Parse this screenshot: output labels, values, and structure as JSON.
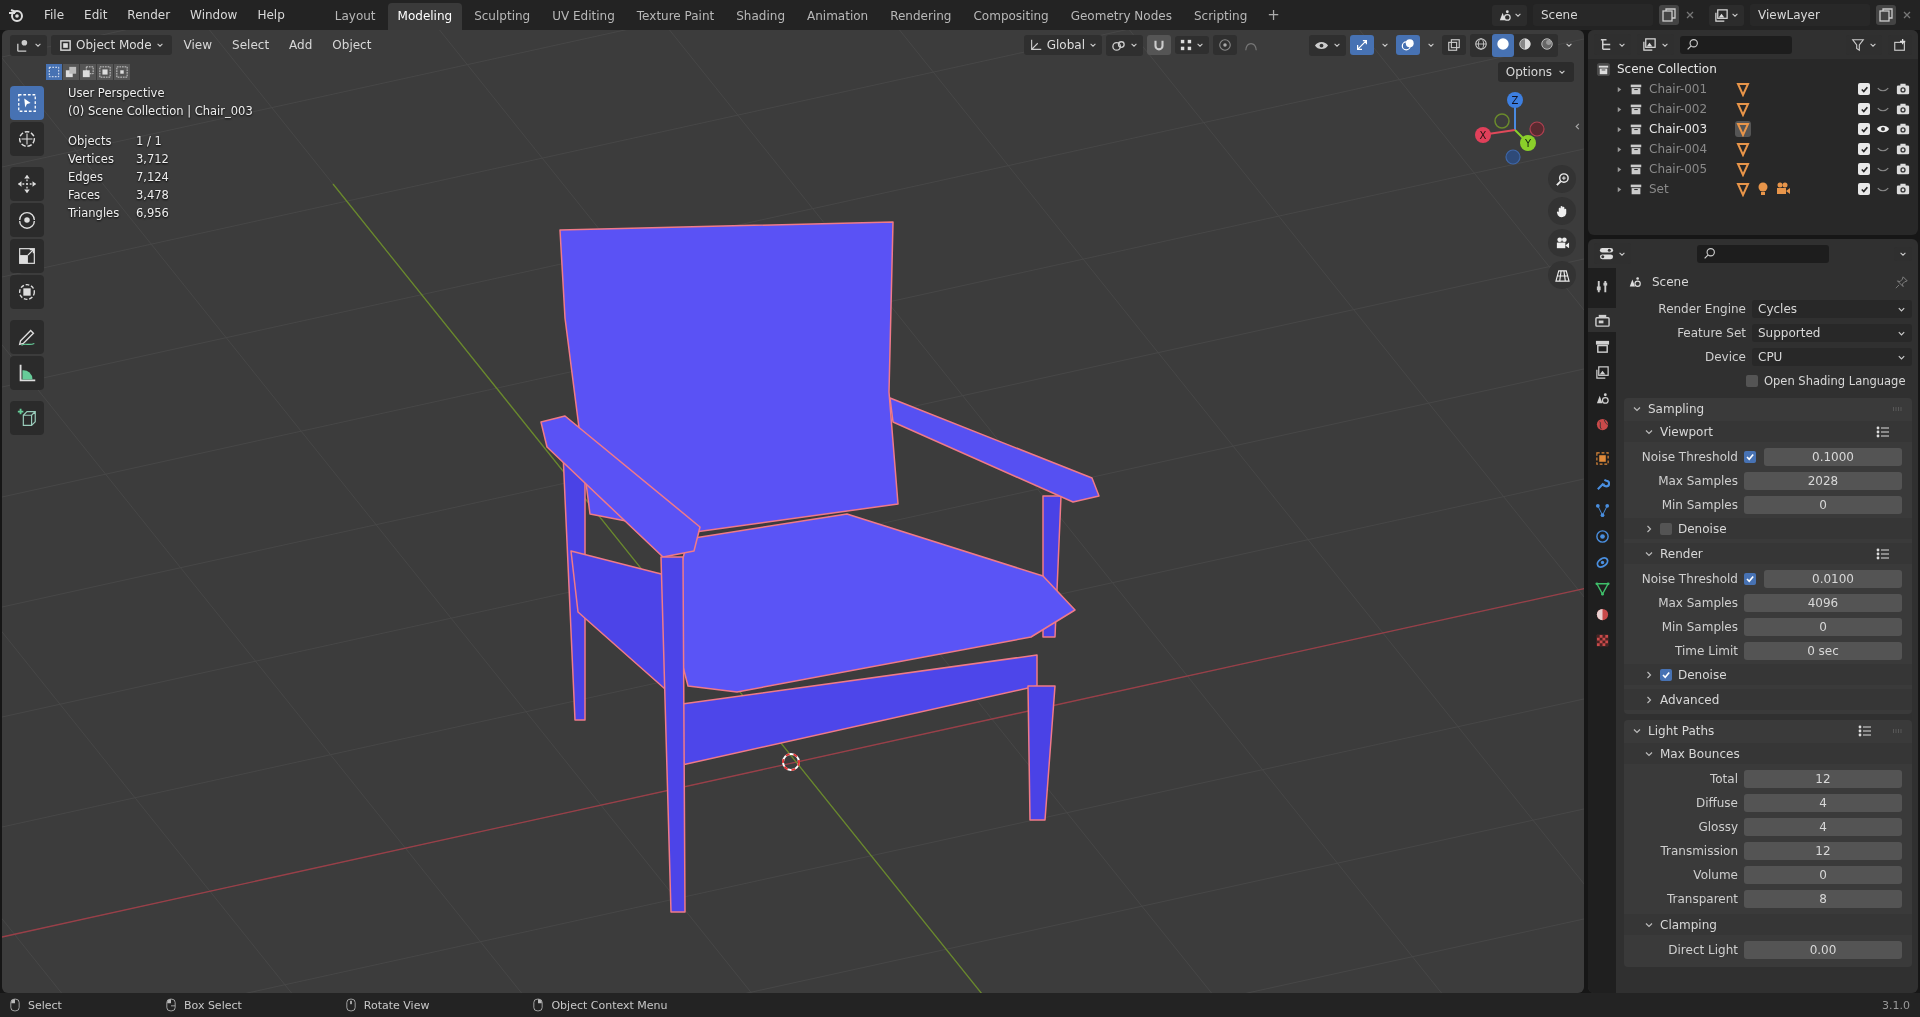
{
  "menu": [
    "File",
    "Edit",
    "Render",
    "Window",
    "Help"
  ],
  "workspaces": [
    {
      "label": "Layout",
      "selected": false
    },
    {
      "label": "Modeling",
      "selected": true
    },
    {
      "label": "Sculpting",
      "selected": false
    },
    {
      "label": "UV Editing",
      "selected": false
    },
    {
      "label": "Texture Paint",
      "selected": false
    },
    {
      "label": "Shading",
      "selected": false
    },
    {
      "label": "Animation",
      "selected": false
    },
    {
      "label": "Rendering",
      "selected": false
    },
    {
      "label": "Compositing",
      "selected": false
    },
    {
      "label": "Geometry Nodes",
      "selected": false
    },
    {
      "label": "Scripting",
      "selected": false
    }
  ],
  "add_workspace": "+",
  "scene_field": "Scene",
  "view_layer_field": "ViewLayer",
  "viewport": {
    "mode": "Object Mode",
    "menus": [
      "View",
      "Select",
      "Add",
      "Object"
    ],
    "orientation": "Global",
    "toggles": {
      "snapping": true,
      "proportional_editing": false,
      "gizmos": true,
      "overlays": true,
      "xray": false
    },
    "shading": [
      {
        "kind": "wireframe",
        "selected": false
      },
      {
        "kind": "solid",
        "selected": true
      },
      {
        "kind": "material",
        "selected": false
      },
      {
        "kind": "rendered",
        "selected": false
      }
    ],
    "select_modes": [
      {
        "kind": "new",
        "selected": true
      },
      {
        "kind": "extend",
        "selected": false
      },
      {
        "kind": "subtract",
        "selected": false
      },
      {
        "kind": "invert",
        "selected": false
      },
      {
        "kind": "intersect",
        "selected": false
      }
    ],
    "options": "Options",
    "tools": [
      {
        "kind": "select",
        "selected": true
      },
      {
        "kind": "cursor",
        "selected": false
      },
      {
        "kind": "move",
        "selected": false
      },
      {
        "kind": "rotate",
        "selected": false
      },
      {
        "kind": "scale",
        "selected": false
      },
      {
        "kind": "transform",
        "selected": false
      },
      {
        "kind": "annotate",
        "selected": false
      },
      {
        "kind": "measure",
        "selected": false
      },
      {
        "kind": "add_cube",
        "selected": false
      }
    ],
    "overlay_lines": [
      "User Perspective",
      "(0) Scene Collection | Chair_003"
    ],
    "stats": [
      {
        "label": "Objects",
        "value": "1 / 1"
      },
      {
        "label": "Vertices",
        "value": "3,712"
      },
      {
        "label": "Edges",
        "value": "7,124"
      },
      {
        "label": "Faces",
        "value": "3,478"
      },
      {
        "label": "Triangles",
        "value": "6,956"
      }
    ],
    "gizmo": {
      "x": "X",
      "y": "Y",
      "z": "Z"
    }
  },
  "outliner": {
    "root": "Scene Collection",
    "items": [
      {
        "name": "Chair-001",
        "selected": false,
        "visible": false,
        "checked": true,
        "objects": [
          {
            "kind": "mesh"
          }
        ]
      },
      {
        "name": "Chair-002",
        "selected": false,
        "visible": false,
        "checked": true,
        "objects": [
          {
            "kind": "mesh"
          }
        ]
      },
      {
        "name": "Chair-003",
        "selected": true,
        "visible": true,
        "checked": true,
        "objects": [
          {
            "kind": "mesh"
          }
        ]
      },
      {
        "name": "Chair-004",
        "selected": false,
        "visible": false,
        "checked": true,
        "objects": [
          {
            "kind": "mesh"
          }
        ]
      },
      {
        "name": "Chair-005",
        "selected": false,
        "visible": false,
        "checked": true,
        "objects": [
          {
            "kind": "mesh"
          }
        ]
      },
      {
        "name": "Set",
        "selected": false,
        "visible": false,
        "checked": true,
        "objects": [
          {
            "kind": "mesh"
          },
          {
            "kind": "light"
          },
          {
            "kind": "camera"
          }
        ]
      }
    ]
  },
  "properties": {
    "tabs": [
      {
        "kind": "tool",
        "selected": false
      },
      {
        "kind": "render",
        "selected": true
      },
      {
        "kind": "output",
        "selected": false
      },
      {
        "kind": "view_layer",
        "selected": false
      },
      {
        "kind": "scene",
        "selected": false
      },
      {
        "kind": "world",
        "selected": false
      },
      {
        "kind": "object",
        "selected": false
      },
      {
        "kind": "modifiers",
        "selected": false
      },
      {
        "kind": "particles",
        "selected": false
      },
      {
        "kind": "physics",
        "selected": false
      },
      {
        "kind": "constraints",
        "selected": false
      },
      {
        "kind": "data",
        "selected": false
      },
      {
        "kind": "material",
        "selected": false
      },
      {
        "kind": "texture",
        "selected": false
      }
    ],
    "context": "Scene",
    "rows": [
      {
        "kind": "dropdown",
        "label": "Render Engine",
        "value": "Cycles"
      },
      {
        "kind": "dropdown",
        "label": "Feature Set",
        "value": "Supported"
      },
      {
        "kind": "dropdown",
        "label": "Device",
        "value": "CPU"
      },
      {
        "kind": "checkbox",
        "label": "Open Shading Language",
        "checked": false
      },
      {
        "kind": "panel",
        "title": "Sampling",
        "expanded": true,
        "presets": false,
        "children": [
          {
            "kind": "subpanel",
            "title": "Viewport",
            "expanded": true,
            "presets": true,
            "children": [
              {
                "kind": "number",
                "label": "Noise Threshold",
                "checked": true,
                "value": "0.1000"
              },
              {
                "kind": "number",
                "label": "Max Samples",
                "value": "2028"
              },
              {
                "kind": "number",
                "label": "Min Samples",
                "value": "0"
              },
              {
                "kind": "subpanel",
                "title": "Denoise",
                "expanded": false,
                "presets": false,
                "checked": false
              }
            ]
          },
          {
            "kind": "subpanel",
            "title": "Render",
            "expanded": true,
            "presets": true,
            "children": [
              {
                "kind": "number",
                "label": "Noise Threshold",
                "checked": true,
                "value": "0.0100"
              },
              {
                "kind": "number",
                "label": "Max Samples",
                "value": "4096"
              },
              {
                "kind": "number",
                "label": "Min Samples",
                "value": "0"
              },
              {
                "kind": "number",
                "label": "Time Limit",
                "value": "0 sec"
              },
              {
                "kind": "subpanel",
                "title": "Denoise",
                "expanded": false,
                "presets": false,
                "checked": true
              }
            ]
          },
          {
            "kind": "subpanel",
            "title": "Advanced",
            "expanded": false,
            "presets": false
          }
        ]
      },
      {
        "kind": "panel",
        "title": "Light Paths",
        "expanded": true,
        "presets": true,
        "children": [
          {
            "kind": "subpanel",
            "title": "Max Bounces",
            "expanded": true,
            "presets": false,
            "children": [
              {
                "kind": "number",
                "label": "Total",
                "value": "12"
              },
              {
                "kind": "number",
                "label": "Diffuse",
                "value": "4"
              },
              {
                "kind": "number",
                "label": "Glossy",
                "value": "4"
              },
              {
                "kind": "number",
                "label": "Transmission",
                "value": "12"
              },
              {
                "kind": "number",
                "label": "Volume",
                "value": "0"
              },
              {
                "kind": "number",
                "label": "Transparent",
                "value": "8"
              }
            ]
          },
          {
            "kind": "subpanel",
            "title": "Clamping",
            "expanded": true,
            "presets": false,
            "children": [
              {
                "kind": "number",
                "label": "Direct Light",
                "value": "0.00"
              }
            ]
          }
        ]
      }
    ]
  },
  "status_bar": {
    "items": [
      {
        "kind": "mouse_left",
        "label": "Select"
      },
      {
        "kind": "mouse_drag",
        "label": "Box Select"
      },
      {
        "kind": "mouse_middle",
        "label": "Rotate View"
      },
      {
        "kind": "mouse_right",
        "label": "Object Context Menu"
      }
    ],
    "version": "3.1.0"
  }
}
